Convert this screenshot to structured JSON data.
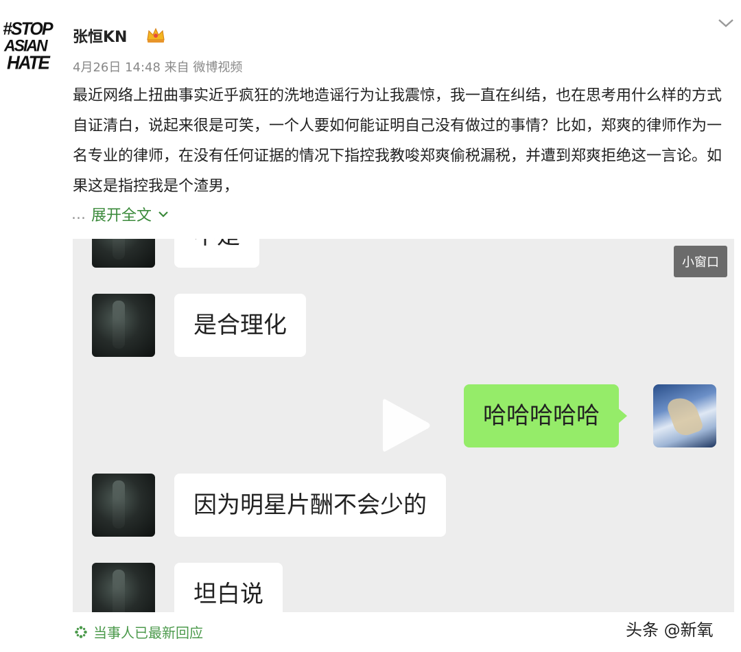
{
  "post": {
    "avatar_text": [
      "#STOP",
      "ASIAN",
      "HATE"
    ],
    "username": "张恒KN",
    "badge_icon": "crown-vip-icon",
    "meta": "4月26日 14:48 来自 微博视频",
    "body": "最近网络上扭曲事实近乎疯狂的洗地造谣行为让我震惊，我一直在纠结，也在思考用什么样的方式自证清白，说起来很是可笑，一个人要如何能证明自己没有做过的事情？比如，郑爽的律师作为一名专业的律师，在没有任何证据的情况下指控我教唆郑爽偷税漏税，并遭到郑爽拒绝这一言论。如果这是指控我是个渣男，",
    "expand_dots": "...",
    "expand_label": "展开全文"
  },
  "video": {
    "mini_window_label": "小窗口",
    "messages": [
      {
        "side": "left",
        "text": "不是"
      },
      {
        "side": "left",
        "text": "是合理化"
      },
      {
        "side": "right",
        "text": "哈哈哈哈哈"
      },
      {
        "side": "left",
        "text": "因为明星片酬不会少的"
      },
      {
        "side": "left",
        "text": "坦白说"
      }
    ]
  },
  "footer": {
    "reply_icon": "sparkle-icon",
    "reply_text": "当事人已最新回应",
    "watermark": "头条 @新氧"
  },
  "colors": {
    "accent_green": "#3b8a3b",
    "bubble_green": "#95ec69",
    "video_bg": "#ededed"
  }
}
